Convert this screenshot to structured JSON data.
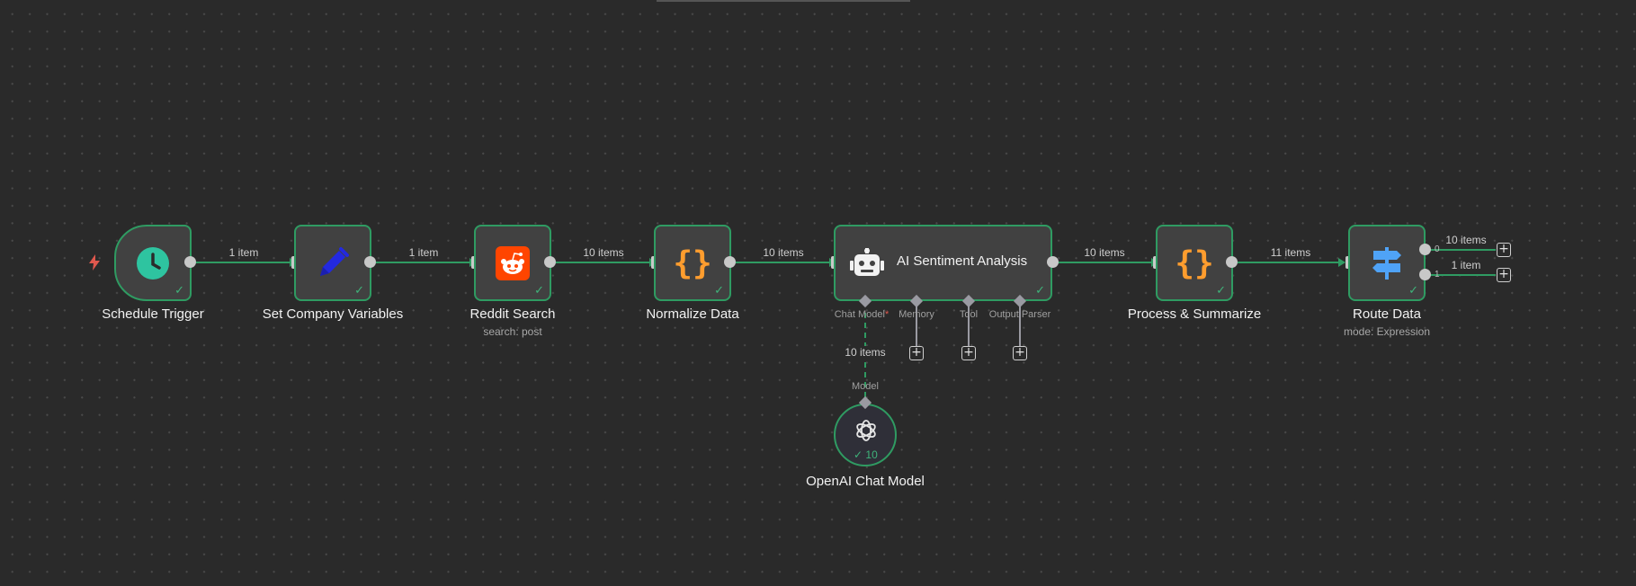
{
  "nodes": {
    "schedule_trigger": {
      "label": "Schedule Trigger"
    },
    "set_company_variables": {
      "label": "Set Company Variables"
    },
    "reddit_search": {
      "label": "Reddit Search",
      "subtitle": "search: post"
    },
    "normalize_data": {
      "label": "Normalize Data"
    },
    "ai_sentiment_analysis": {
      "label": "AI Sentiment Analysis",
      "ports": {
        "chat_model": "Chat Model",
        "required_mark": "*",
        "memory": "Memory",
        "tool": "Tool",
        "output_parser": "Output Parser"
      }
    },
    "process_summarize": {
      "label": "Process & Summarize"
    },
    "route_data": {
      "label": "Route Data",
      "subtitle": "mode: Expression",
      "outputs": [
        "0",
        "1"
      ]
    },
    "openai_chat_model": {
      "label": "OpenAI Chat Model",
      "run_count": "10",
      "port_label": "Model"
    }
  },
  "edges": {
    "trigger_to_set": "1 item",
    "set_to_reddit": "1 item",
    "reddit_to_normalize": "10 items",
    "normalize_to_ai": "10 items",
    "ai_to_process": "10 items",
    "process_to_route": "11 items",
    "route_out0": "10 items",
    "route_out1": "1 item",
    "model_to_ai": "10 items"
  },
  "colors": {
    "canvas": "#2a2a2a",
    "node_bg": "#414141",
    "success": "#2f9b62",
    "trigger_red": "#e0584e",
    "schedule_green": "#2ec4a0",
    "pen_blue": "#2329e0",
    "reddit_orange": "#ff4500",
    "code_orange": "#ff9d2e",
    "route_blue": "#4fa3f7"
  }
}
